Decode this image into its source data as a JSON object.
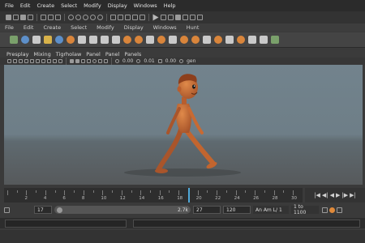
{
  "menubar": {
    "items": [
      "File",
      "Edit",
      "Create",
      "Select",
      "Modify",
      "Display",
      "Windows",
      "Help"
    ]
  },
  "menuset": {
    "items": [
      "File",
      "Edit",
      "Create",
      "Select",
      "Modify",
      "Display",
      "Windows",
      "Hunt"
    ]
  },
  "panel_menu": {
    "items": [
      "Presplay",
      "Mixing",
      "Tigrholaw",
      "Panel",
      "Panel",
      "Panels"
    ]
  },
  "panel_toolbar": {
    "value_a": "0.00",
    "value_b": "0.01",
    "value_c": "0.00",
    "label": "gen"
  },
  "timeline": {
    "ticks": [
      "2",
      "4",
      "6",
      "8",
      "10",
      "12",
      "14",
      "16",
      "18",
      "20",
      "22",
      "24",
      "26",
      "28",
      "30"
    ],
    "current_frame": 19
  },
  "playback": {
    "icons": [
      "go-to-start-icon",
      "step-back-icon",
      "play-back-icon",
      "play-forward-icon",
      "step-forward-icon",
      "go-to-end-icon"
    ],
    "glyphs": [
      "|◀",
      "◀|",
      "◀",
      "▶",
      "|▶",
      "▶|"
    ]
  },
  "range": {
    "start_field": "17",
    "slider_value": "2.7k",
    "current": "27",
    "end_field": "120",
    "anim_layer": "An Am L/ 1",
    "range_display": "1 to 1100"
  },
  "colors": {
    "character": "#c76a34",
    "playhead": "#4fa8d8",
    "viewport_sky": "#72838d",
    "viewport_floor": "#56595b"
  }
}
